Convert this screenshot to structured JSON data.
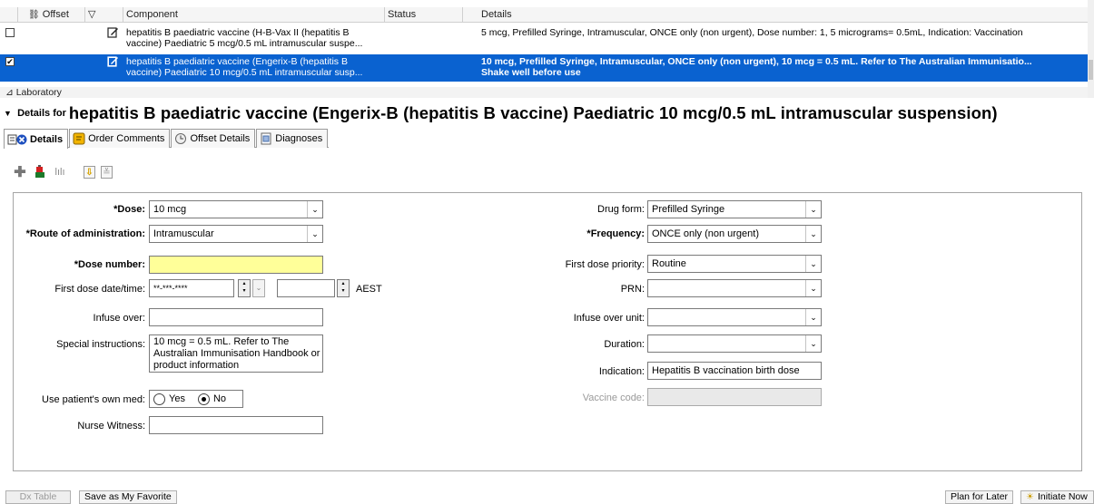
{
  "grid": {
    "headers": {
      "offset": "Offset",
      "component": "Component",
      "status": "Status",
      "details": "Details"
    },
    "rows": [
      {
        "checked": false,
        "component_line1": "hepatitis B paediatric vaccine (H-B-Vax II (hepatitis B",
        "component_line2": "vaccine) Paediatric 5 mcg/0.5 mL intramuscular suspe...",
        "status": "",
        "details_line1": "5 mcg, Prefilled Syringe, Intramuscular, ONCE only (non urgent), Dose number: 1, 5 micrograms= 0.5mL, Indication: Vaccination",
        "details_line2": ""
      },
      {
        "checked": true,
        "component_line1": "hepatitis B paediatric vaccine (Engerix-B (hepatitis B",
        "component_line2": "vaccine) Paediatric 10 mcg/0.5 mL intramuscular susp...",
        "status": "",
        "details_line1": "10 mcg, Prefilled Syringe, Intramuscular, ONCE only (non urgent), 10 mcg = 0.5 mL. Refer to The Australian Immunisatio...",
        "details_line2": "Shake well before use"
      }
    ],
    "section": "⊿ Laboratory"
  },
  "details_header": {
    "prefix": "Details for",
    "title": "hepatitis B paediatric vaccine (Engerix-B (hepatitis B vaccine) Paediatric 10 mcg/0.5 mL intramuscular suspension)"
  },
  "tabs": [
    {
      "label": "Details",
      "icon": "details-icon",
      "active": true
    },
    {
      "label": "Order Comments",
      "icon": "comments-icon",
      "active": false
    },
    {
      "label": "Offset Details",
      "icon": "clock-icon",
      "active": false
    },
    {
      "label": "Diagnoses",
      "icon": "diagnoses-icon",
      "active": false
    }
  ],
  "form": {
    "left": {
      "dose": {
        "label": "*Dose:",
        "value": "10 mcg"
      },
      "route": {
        "label": "*Route of administration:",
        "value": "Intramuscular"
      },
      "dose_number": {
        "label": "*Dose number:",
        "value": ""
      },
      "first_dose": {
        "label": "First dose date/time:",
        "date": "**-***-****",
        "time": "",
        "tz": "AEST"
      },
      "infuse_over": {
        "label": "Infuse over:",
        "value": ""
      },
      "special": {
        "label": "Special instructions:",
        "value": "10 mcg = 0.5 mL. Refer to The Australian Immunisation Handbook or product information"
      },
      "own_med": {
        "label": "Use patient's own med:",
        "yes": "Yes",
        "no": "No",
        "selected": "No"
      },
      "nurse_witness": {
        "label": "Nurse Witness:",
        "value": ""
      }
    },
    "right": {
      "drug_form": {
        "label": "Drug form:",
        "value": "Prefilled Syringe"
      },
      "frequency": {
        "label": "*Frequency:",
        "value": "ONCE only (non urgent)"
      },
      "priority": {
        "label": "First dose priority:",
        "value": "Routine"
      },
      "prn": {
        "label": "PRN:",
        "value": ""
      },
      "infuse_unit": {
        "label": "Infuse over unit:",
        "value": ""
      },
      "duration": {
        "label": "Duration:",
        "value": ""
      },
      "indication": {
        "label": "Indication:",
        "value": "Hepatitis B vaccination birth dose"
      },
      "vaccine_code": {
        "label": "Vaccine code:",
        "value": ""
      }
    }
  },
  "bottom": {
    "dx_table": "Dx Table",
    "save_favorite": "Save as My Favorite",
    "plan_later": "Plan for Later",
    "initiate_now": "Initiate Now"
  },
  "colors": {
    "selection": "#0a62d0",
    "required_field": "#ffff99"
  }
}
